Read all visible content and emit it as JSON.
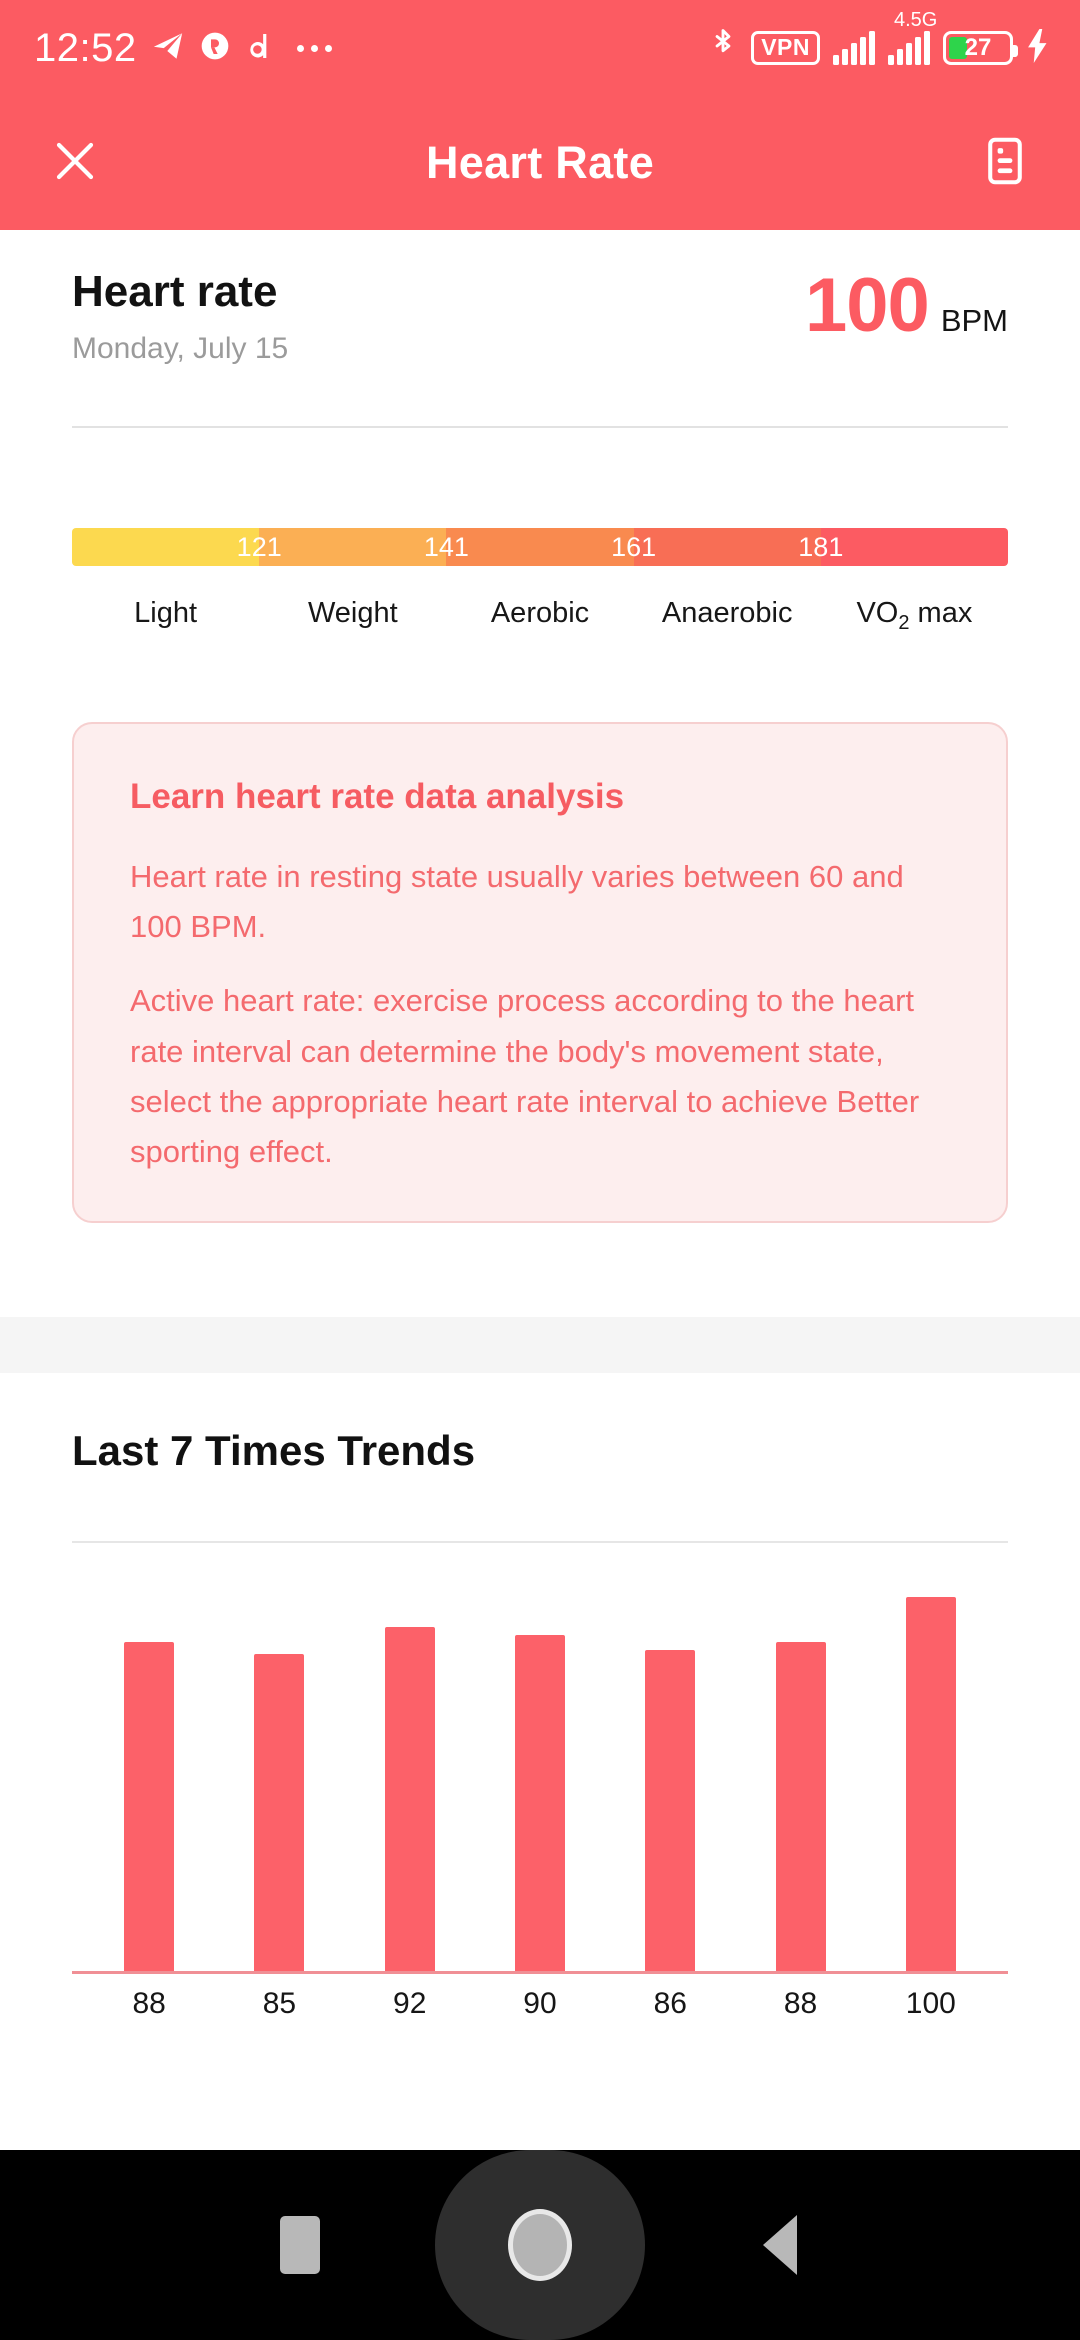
{
  "status_bar": {
    "time": "12:52",
    "left_icons": [
      "telegram-icon",
      "circle-app-icon",
      "d-app-icon",
      "more-dots-icon"
    ],
    "network_label": "4.5G",
    "vpn_label": "VPN",
    "battery_percent": "27",
    "right_icons": [
      "bluetooth-icon",
      "vpn-icon",
      "signal-bars-icon",
      "mobile-data-icon",
      "battery-icon",
      "charging-bolt-icon"
    ],
    "colors": {
      "background": "#FC5B62",
      "battery_fill": "#2ED44B"
    }
  },
  "app_bar": {
    "title": "Heart Rate",
    "close_icon": "close-icon",
    "menu_icon": "history-list-icon",
    "background": "#FC5B62"
  },
  "summary": {
    "title": "Heart rate",
    "date": "Monday, July 15",
    "value": "100",
    "unit": "BPM",
    "accent": "#FC5B62"
  },
  "zone_bar": {
    "ticks": [
      "121",
      "141",
      "161",
      "181"
    ],
    "segment_colors": [
      "#FCD94F",
      "#FBAF54",
      "#F98A4F",
      "#F86E55",
      "#FC5B62"
    ],
    "marker_position_percent": 20,
    "marker_color": "#FBCE3C",
    "labels": [
      {
        "text": "Light"
      },
      {
        "text": "Weight"
      },
      {
        "text": "Aerobic"
      },
      {
        "text": "Anaerobic"
      },
      {
        "text": "VO",
        "sub": "2",
        "suffix": " max"
      }
    ]
  },
  "info_card": {
    "heading": "Learn heart rate data analysis",
    "paragraphs": [
      "Heart rate in resting state usually varies between 60 and 100 BPM.",
      "Active heart rate: exercise process according to the heart rate interval can determine the body's movement state, select the appropriate heart rate interval to achieve Better sporting effect."
    ],
    "background": "#FDEEEE",
    "border": "#F6CFCF",
    "heading_color": "#F65C62",
    "text_color": "#F46A6E"
  },
  "trends": {
    "title": "Last 7 Times Trends"
  },
  "chart_data": {
    "type": "bar",
    "title": "Last 7 Times Trends",
    "categories": [
      "88",
      "85",
      "92",
      "90",
      "86",
      "88",
      "100"
    ],
    "values": [
      88,
      85,
      92,
      90,
      86,
      88,
      100
    ],
    "xlabel": "",
    "ylabel": "",
    "ylim": [
      0,
      110
    ],
    "grid": false,
    "legend": "none",
    "bar_color": "#FC6169",
    "axis_color": "#F08F95"
  },
  "nav_bar": {
    "recents_icon": "square-recents-icon",
    "home_icon": "circle-home-icon",
    "back_icon": "triangle-back-icon",
    "background": "#000000"
  }
}
